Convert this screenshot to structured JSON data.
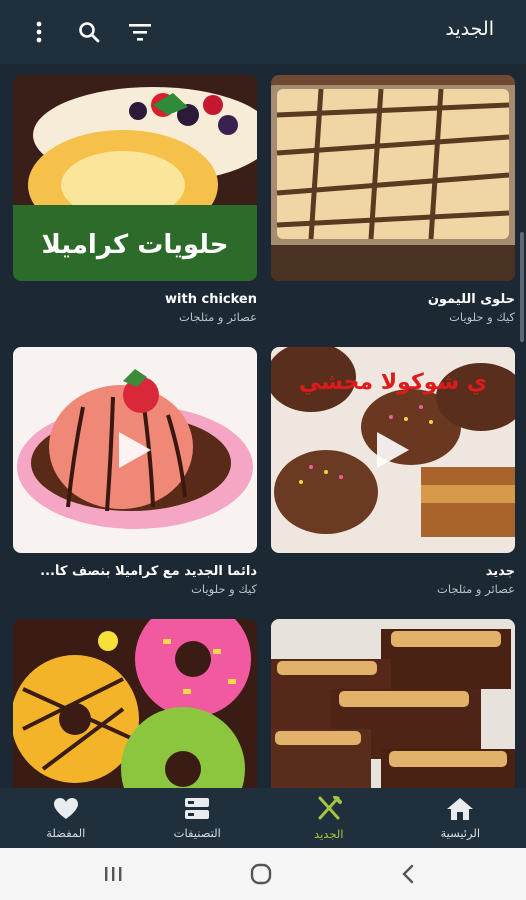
{
  "appbar": {
    "title": "الجديد"
  },
  "cards": [
    {
      "title": "حلوى الليمون",
      "category": "كيك و حلويات",
      "video": false
    },
    {
      "title": "with chicken",
      "category": "عصائر و مثلجات",
      "video": false,
      "overlay_text": "حلويات كراميلا"
    },
    {
      "title": "جديد",
      "category": "عصائر و مثلجات",
      "video": true,
      "overlay_text": "ي شوكولا محشي"
    },
    {
      "title": "دائما الجديد مع كراميلا بنصف كأ...",
      "category": "كيك و حلويات",
      "video": true
    },
    {
      "title": "",
      "category": "",
      "video": false
    },
    {
      "title": "",
      "category": "",
      "video": false
    }
  ],
  "bottom_nav": [
    {
      "label": "الرئيسية",
      "icon": "home-icon",
      "active": false
    },
    {
      "label": "الجديد",
      "icon": "fork-knife-icon",
      "active": true
    },
    {
      "label": "التصنيفات",
      "icon": "categories-icon",
      "active": false
    },
    {
      "label": "المفضلة",
      "icon": "heart-icon",
      "active": false
    }
  ],
  "colors": {
    "background": "#1c2833",
    "bar": "#1f2f3b",
    "accent": "#a5c441"
  }
}
